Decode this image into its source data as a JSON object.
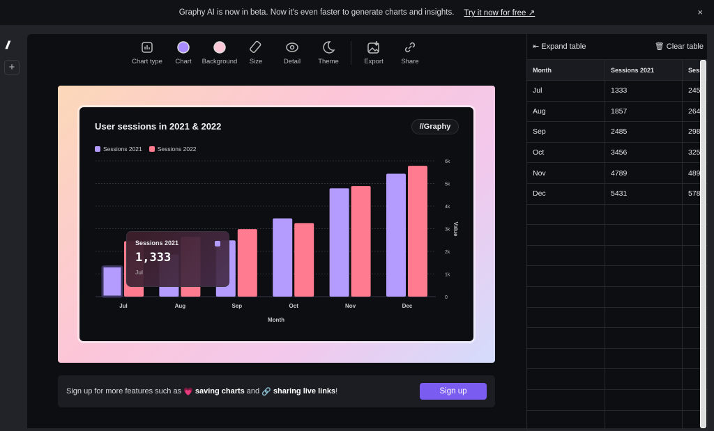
{
  "banner": {
    "text": "Graphy AI is now in beta. Now it's even faster to generate charts and insights.",
    "link": "Try it now for free ↗",
    "close": "×"
  },
  "sidebar": {
    "logo": "//",
    "add": "+"
  },
  "toolbar": [
    {
      "label": "Chart type",
      "icon": "chart-type-icon"
    },
    {
      "label": "Chart",
      "icon": "color-swatch-icon",
      "color": "#a98cff"
    },
    {
      "label": "Background",
      "icon": "color-swatch-icon",
      "color": "#fbc8d8"
    },
    {
      "label": "Size",
      "icon": "ruler-icon"
    },
    {
      "label": "Detail",
      "icon": "eye-icon"
    },
    {
      "label": "Theme",
      "icon": "moon-icon"
    },
    {
      "label": "Export",
      "icon": "export-image-icon"
    },
    {
      "label": "Share",
      "icon": "link-icon"
    }
  ],
  "badge": "//Graphy",
  "tooltip": {
    "series": "Sessions 2021",
    "value": "1,333",
    "month": "Jul"
  },
  "signup": {
    "pre": "Sign up for more features such as",
    "heart": "💗",
    "b1": "saving charts",
    "mid": "and",
    "link": "🔗",
    "b2": "sharing live links",
    "end": "!",
    "button": "Sign up"
  },
  "table": {
    "expand": "Expand table",
    "clear": "Clear table",
    "headers": [
      "Month",
      "Sessions 2021",
      "Sess"
    ],
    "rows": [
      [
        "Jul",
        "1333",
        "245"
      ],
      [
        "Aug",
        "1857",
        "264"
      ],
      [
        "Sep",
        "2485",
        "298"
      ],
      [
        "Oct",
        "3456",
        "325"
      ],
      [
        "Nov",
        "4789",
        "489"
      ],
      [
        "Dec",
        "5431",
        "578"
      ]
    ]
  },
  "chart_data": {
    "type": "bar",
    "title": "User sessions in 2021 & 2022",
    "xlabel": "Month",
    "ylabel": "Value",
    "categories": [
      "Jul",
      "Aug",
      "Sep",
      "Oct",
      "Nov",
      "Dec"
    ],
    "series": [
      {
        "name": "Sessions 2021",
        "color": "#b49cff",
        "values": [
          1333,
          1857,
          2485,
          3456,
          4789,
          5431
        ]
      },
      {
        "name": "Sessions 2022",
        "color": "#ff7b8f",
        "values": [
          2450,
          2640,
          2980,
          3250,
          4890,
          5780
        ]
      }
    ],
    "ylim": [
      0,
      6000
    ],
    "yticks": [
      "0",
      "1k",
      "2k",
      "3k",
      "4k",
      "5k",
      "6k"
    ],
    "grid": true,
    "legend": "top-left"
  }
}
